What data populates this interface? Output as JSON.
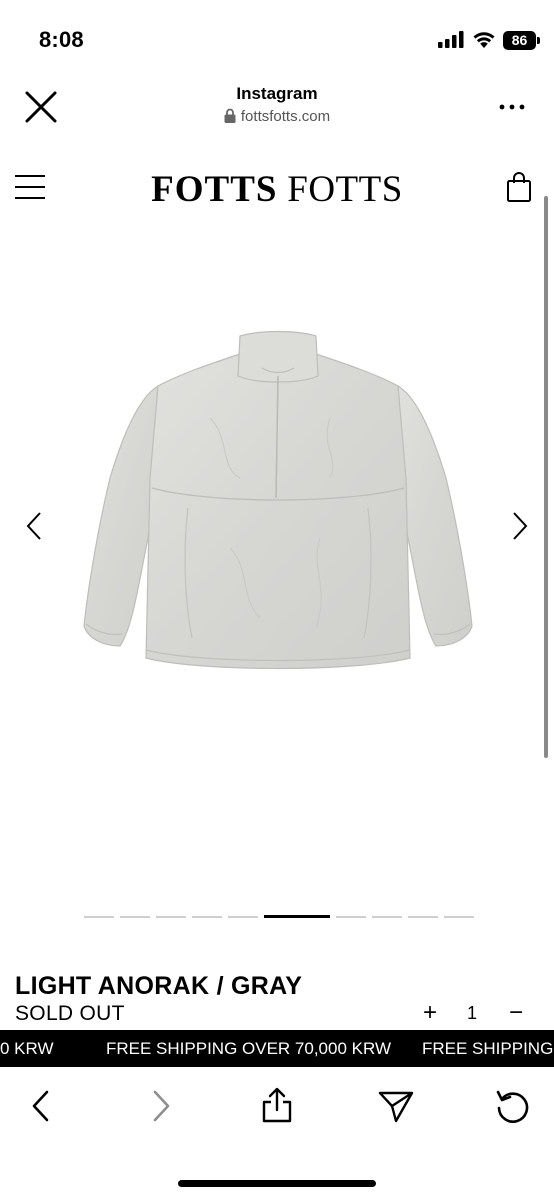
{
  "status_bar": {
    "time": "8:08",
    "battery": "86"
  },
  "browser": {
    "title": "Instagram",
    "url": "fottsfotts.com"
  },
  "site": {
    "logo_primary": "FOTTS",
    "logo_secondary": "FOTTS"
  },
  "carousel": {
    "image_count": 10,
    "active_index": 5
  },
  "product": {
    "name": "LIGHT ANORAK / GRAY",
    "status": "SOLD OUT",
    "quantity": "1",
    "plus_label": "+",
    "minus_label": "−"
  },
  "banner": {
    "lead_fragment": "0 KRW",
    "message": "FREE SHIPPING OVER 70,000 KRW",
    "trail_fragment": "FREE SHIPPING OV"
  },
  "icons": {
    "close": "close-icon",
    "lock": "lock-icon",
    "more": "more-icon",
    "menu": "menu-icon",
    "cart": "shopping-bag-icon",
    "prev": "chevron-left-icon",
    "next": "chevron-right-icon",
    "back": "back-icon",
    "forward": "forward-icon",
    "share": "share-icon",
    "send": "send-icon",
    "reload": "reload-icon"
  },
  "colors": {
    "banner_bg": "#000000",
    "banner_text": "#ffffff",
    "jacket": "#d9d9d6",
    "dot_inactive": "#cfcfcf"
  }
}
